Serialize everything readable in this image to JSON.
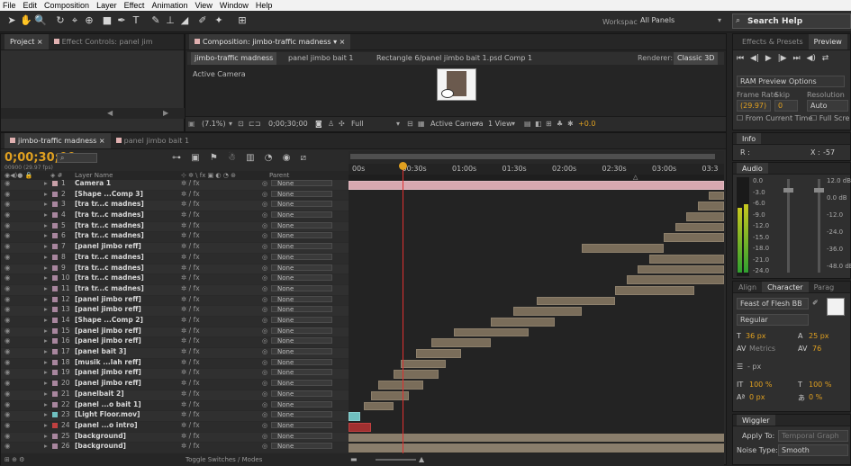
{
  "menubar": {
    "items": [
      "File",
      "Edit",
      "Composition",
      "Layer",
      "Effect",
      "Animation",
      "View",
      "Window",
      "Help"
    ]
  },
  "toolbar": {
    "workspace_label": "Workspace:",
    "workspace_value": "All Panels",
    "search_placeholder": "Search Help"
  },
  "project_panel": {
    "tab1": "Project",
    "tab2": "Effect Controls: panel jim"
  },
  "comp_panel": {
    "tab": "Composition: jimbo-traffic madness",
    "breadcrumb1": "jimbo-traffic madness",
    "breadcrumb2": "panel jimbo bait 1",
    "breadcrumb3": "Rectangle 6/panel jimbo bait 1.psd Comp 1",
    "renderer_label": "Renderer:",
    "renderer_value": "Classic 3D",
    "active_camera": "Active Camera",
    "zoom": "(7.1%)",
    "timecode": "0;00;30;00",
    "quality": "Full",
    "view_camera": "Active Camera",
    "view_count": "1 View",
    "exposure": "+0.0"
  },
  "right_panel": {
    "tab_effects": "Effects & Presets",
    "tab_preview": "Preview",
    "ram_options": "RAM Preview Options",
    "frame_rate_label": "Frame Rate",
    "skip_label": "Skip",
    "resolution_label": "Resolution",
    "frame_rate": "(29.97)",
    "skip": "0",
    "resolution": "Auto",
    "from_current": "From Current Time",
    "full_screen": "Full Scre"
  },
  "info_panel": {
    "tab": "Info",
    "r_label": "R :",
    "x_label": "X :",
    "x_value": "-57"
  },
  "audio_panel": {
    "tab": "Audio",
    "left_scale": [
      "0.0",
      "-3.0",
      "-6.0",
      "-9.0",
      "-12.0",
      "-15.0",
      "-18.0",
      "-21.0",
      "-24.0"
    ],
    "right_scale": [
      "12.0 dB",
      "0.0 dB",
      "-12.0",
      "-24.0",
      "-36.0",
      "-48.0 dB"
    ]
  },
  "character_panel": {
    "tab_align": "Align",
    "tab_character": "Character",
    "tab_paragraph": "Parag",
    "font": "Feast of Flesh BB",
    "style": "Regular",
    "size": "36 px",
    "leading": "25 px",
    "kerning": "Metrics",
    "tracking": "76",
    "stroke": "- px",
    "vscale": "100 %",
    "hscale": "100 %",
    "baseline": "0 px",
    "tsume": "0 %"
  },
  "wiggler_panel": {
    "tab": "Wiggler",
    "apply_to_label": "Apply To:",
    "apply_to": "Temporal Graph",
    "noise_label": "Noise Type:",
    "noise": "Smooth"
  },
  "timeline": {
    "tab1": "jimbo-traffic madness",
    "tab2": "panel jimbo bait 1",
    "timecode": "0;00;30;00",
    "frame_info": "00900 (29.97 fps)",
    "col_layer_name": "Layer Name",
    "col_parent": "Parent",
    "toggle_label": "Toggle Switches / Modes",
    "ruler": [
      "00s",
      "00:30s",
      "01:00s",
      "01:30s",
      "02:00s",
      "02:30s",
      "03:00s",
      "03:3"
    ],
    "layers": [
      {
        "num": "1",
        "name": "Camera 1",
        "color": "#c8a0a8"
      },
      {
        "num": "2",
        "name": "[Shape ...Comp 3]",
        "color": "#a8869e"
      },
      {
        "num": "3",
        "name": "[tra tr...c madnes]",
        "color": "#a8869e"
      },
      {
        "num": "4",
        "name": "[tra tr...c madnes]",
        "color": "#a8869e"
      },
      {
        "num": "5",
        "name": "[tra tr...c madnes]",
        "color": "#a8869e"
      },
      {
        "num": "6",
        "name": "[tra tr...c madnes]",
        "color": "#a8869e"
      },
      {
        "num": "7",
        "name": "[panel jimbo reff]",
        "color": "#a8869e"
      },
      {
        "num": "8",
        "name": "[tra tr...c madnes]",
        "color": "#a8869e"
      },
      {
        "num": "9",
        "name": "[tra tr...c madnes]",
        "color": "#a8869e"
      },
      {
        "num": "10",
        "name": "[tra tr...c madnes]",
        "color": "#a8869e"
      },
      {
        "num": "11",
        "name": "[tra tr...c madnes]",
        "color": "#a8869e"
      },
      {
        "num": "12",
        "name": "[panel jimbo reff]",
        "color": "#a8869e"
      },
      {
        "num": "13",
        "name": "[panel jimbo reff]",
        "color": "#a8869e"
      },
      {
        "num": "14",
        "name": "[Shape ...Comp 2]",
        "color": "#a8869e"
      },
      {
        "num": "15",
        "name": "[panel jimbo reff]",
        "color": "#a8869e"
      },
      {
        "num": "16",
        "name": "[panel jimbo reff]",
        "color": "#a8869e"
      },
      {
        "num": "17",
        "name": "[panel bait 3]",
        "color": "#a8869e"
      },
      {
        "num": "18",
        "name": "[musik ...lah reff]",
        "color": "#a8869e"
      },
      {
        "num": "19",
        "name": "[panel jimbo reff]",
        "color": "#a8869e"
      },
      {
        "num": "20",
        "name": "[panel jimbo reff]",
        "color": "#a8869e"
      },
      {
        "num": "21",
        "name": "[panelbait 2]",
        "color": "#a8869e"
      },
      {
        "num": "22",
        "name": "[panel ...o bait 1]",
        "color": "#a8869e"
      },
      {
        "num": "23",
        "name": "[Light Floor.mov]",
        "color": "#6fc0c0"
      },
      {
        "num": "24",
        "name": "[panel ...o intro]",
        "color": "#c04040"
      },
      {
        "num": "25",
        "name": "[background]",
        "color": "#a8869e"
      },
      {
        "num": "26",
        "name": "[background]",
        "color": "#a8869e"
      }
    ],
    "parent_value": "None"
  }
}
